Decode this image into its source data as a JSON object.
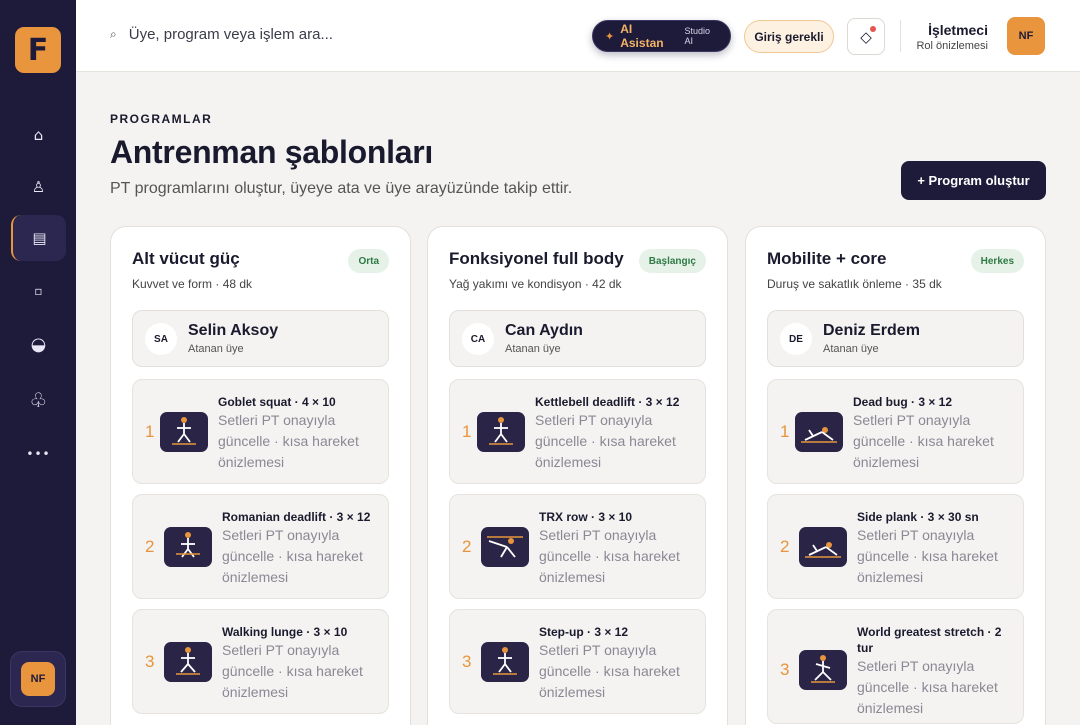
{
  "sidebar": {
    "logo": "F",
    "nav": [
      {
        "icon": "home-icon",
        "glyph": "⌂"
      },
      {
        "icon": "members-icon",
        "glyph": "♙"
      },
      {
        "icon": "programs-icon",
        "glyph": "▤"
      },
      {
        "icon": "square-icon",
        "glyph": "▫"
      },
      {
        "icon": "half-circle-icon",
        "glyph": "◒"
      },
      {
        "icon": "club-icon",
        "glyph": "♧"
      },
      {
        "icon": "more-icon",
        "glyph": "•••"
      }
    ],
    "avatar": "NF"
  },
  "topbar": {
    "search_placeholder": "Üye, program veya işlem ara...",
    "ai_label": "AI Asistan",
    "ai_sub": "Studio AI",
    "login_label": "Giriş gerekli",
    "user_name": "İşletmeci",
    "user_role": "Rol önizlemesi",
    "avatar": "NF"
  },
  "header": {
    "eyebrow": "PROGRAMLAR",
    "title": "Antrenman şablonları",
    "subtitle": "PT programlarını oluştur, üyeye ata ve üye arayüzünde takip ettir.",
    "create_label": "+ Program oluştur"
  },
  "programs": [
    {
      "title": "Alt vücut güç",
      "meta": "Kuvvet ve form · 48 dk",
      "level": "Orta",
      "member": {
        "initials": "SA",
        "name": "Selin Aksoy",
        "role": "Atanan üye"
      },
      "exercises": [
        {
          "num": "1",
          "title": "Goblet squat · 4 × 10",
          "desc": "Setleri PT onayıyla güncelle · kısa hareket önizlemesi"
        },
        {
          "num": "2",
          "title": "Romanian deadlift · 3 × 12",
          "desc": "Setleri PT onayıyla güncelle · kısa hareket önizlemesi"
        },
        {
          "num": "3",
          "title": "Walking lunge · 3 × 10",
          "desc": "Setleri PT onayıyla güncelle · kısa hareket önizlemesi"
        }
      ]
    },
    {
      "title": "Fonksiyonel full body",
      "meta": "Yağ yakımı ve kondisyon · 42 dk",
      "level": "Başlangıç",
      "member": {
        "initials": "CA",
        "name": "Can Aydın",
        "role": "Atanan üye"
      },
      "exercises": [
        {
          "num": "1",
          "title": "Kettlebell deadlift · 3 × 12",
          "desc": "Setleri PT onayıyla güncelle · kısa hareket önizlemesi"
        },
        {
          "num": "2",
          "title": "TRX row · 3 × 10",
          "desc": "Setleri PT onayıyla güncelle · kısa hareket önizlemesi"
        },
        {
          "num": "3",
          "title": "Step-up · 3 × 12",
          "desc": "Setleri PT onayıyla güncelle · kısa hareket önizlemesi"
        }
      ]
    },
    {
      "title": "Mobilite + core",
      "meta": "Duruş ve sakatlık önleme · 35 dk",
      "level": "Herkes",
      "member": {
        "initials": "DE",
        "name": "Deniz Erdem",
        "role": "Atanan üye"
      },
      "exercises": [
        {
          "num": "1",
          "title": "Dead bug · 3 × 12",
          "desc": "Setleri PT onayıyla güncelle · kısa hareket önizlemesi"
        },
        {
          "num": "2",
          "title": "Side plank · 3 × 30 sn",
          "desc": "Setleri PT onayıyla güncelle · kısa hareket önizlemesi"
        },
        {
          "num": "3",
          "title": "World greatest stretch · 2 tur",
          "desc": "Setleri PT onayıyla güncelle · kısa hareket önizlemesi"
        }
      ]
    }
  ],
  "colors": {
    "sidebar": "#1e1a3a",
    "accent": "#e8953d",
    "badge_bg": "#e6f2e8",
    "badge_text": "#2f7a45"
  }
}
